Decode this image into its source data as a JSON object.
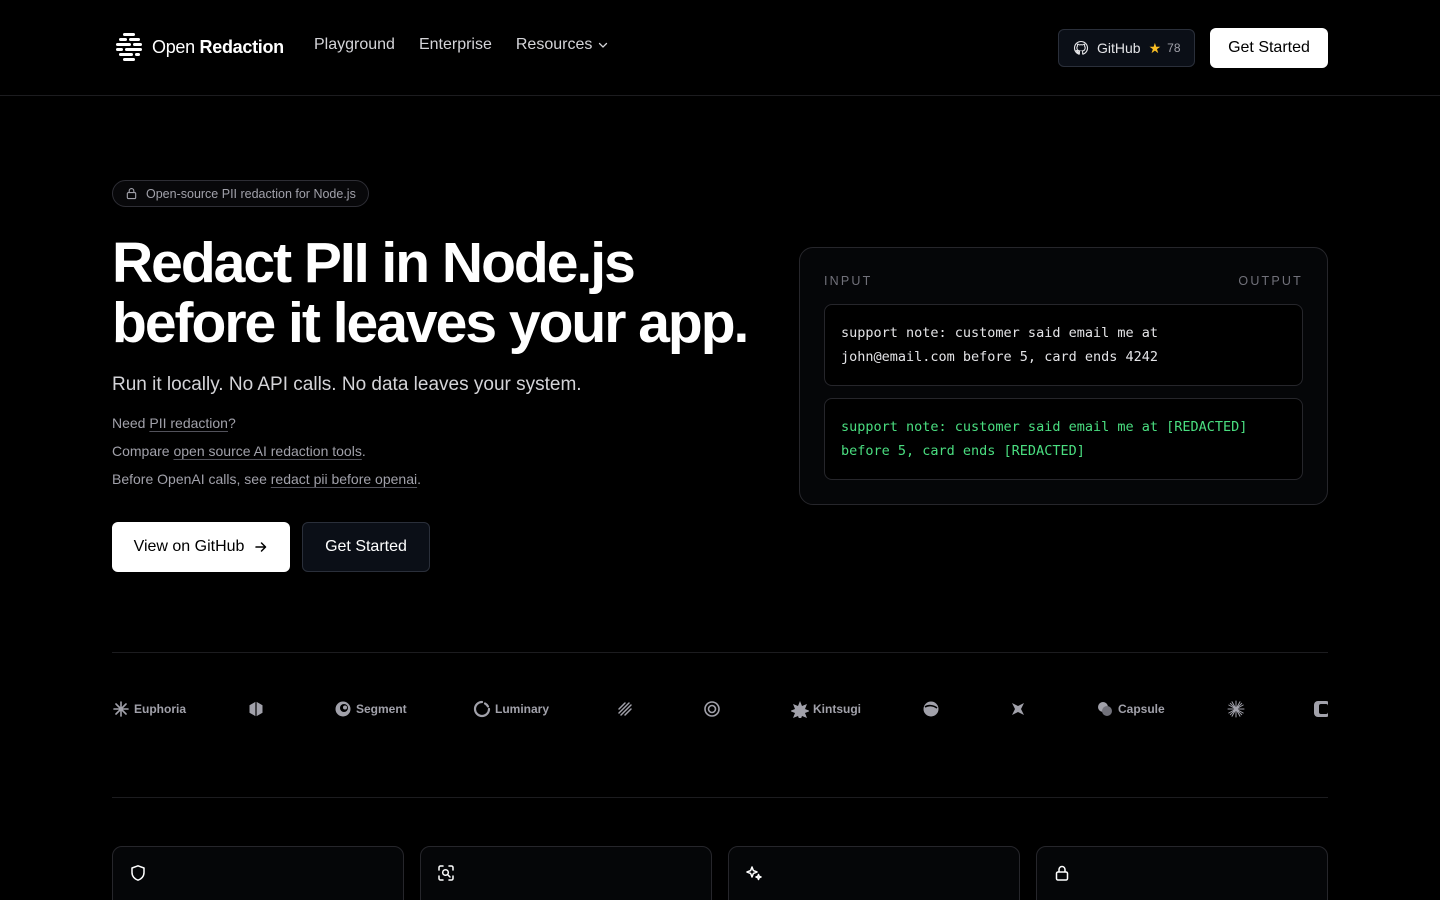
{
  "nav": {
    "brand_open": "Open",
    "brand_redaction": "Redaction",
    "links": [
      {
        "label": "Playground"
      },
      {
        "label": "Enterprise"
      },
      {
        "label": "Resources"
      }
    ],
    "github_label": "GitHub",
    "github_stars": "78",
    "get_started": "Get Started"
  },
  "hero": {
    "badge": "Open-source PII redaction for Node.js",
    "title_line1": "Redact PII in Node.js",
    "title_line2": "before it leaves your app.",
    "subtitle": "Run it locally. No API calls. No data leaves your system.",
    "line1_prefix": "Need ",
    "line1_link": "PII redaction",
    "line1_suffix": "?",
    "line2_prefix": "Compare ",
    "line2_link": "open source AI redaction tools",
    "line2_suffix": ".",
    "line3_prefix": "Before OpenAI calls, see ",
    "line3_link": "redact pii before openai",
    "line3_suffix": ".",
    "cta_github": "View on GitHub",
    "cta_get_started": "Get Started"
  },
  "demo": {
    "input_label": "INPUT",
    "output_label": "OUTPUT",
    "input_line1": "support note: customer said email me at",
    "input_line2": "john@email.com before 5, card ends 4242",
    "output_line1": "support note: customer said email me at [REDACTED]",
    "output_line2": "before 5, card ends [REDACTED]"
  },
  "logos": [
    {
      "name": "Euphoria"
    },
    {
      "name": ""
    },
    {
      "name": "Segment"
    },
    {
      "name": "Luminary"
    },
    {
      "name": ""
    },
    {
      "name": ""
    },
    {
      "name": "Kintsugi"
    },
    {
      "name": ""
    },
    {
      "name": ""
    },
    {
      "name": "Capsule"
    },
    {
      "name": ""
    },
    {
      "name": ""
    }
  ],
  "features": [
    {
      "icon": "shield-icon"
    },
    {
      "icon": "scan-icon"
    },
    {
      "icon": "sparkles-icon"
    },
    {
      "icon": "lock-icon"
    }
  ],
  "colors": {
    "background": "#000000",
    "accent_green": "#4ade80",
    "star": "#fbbf24"
  }
}
